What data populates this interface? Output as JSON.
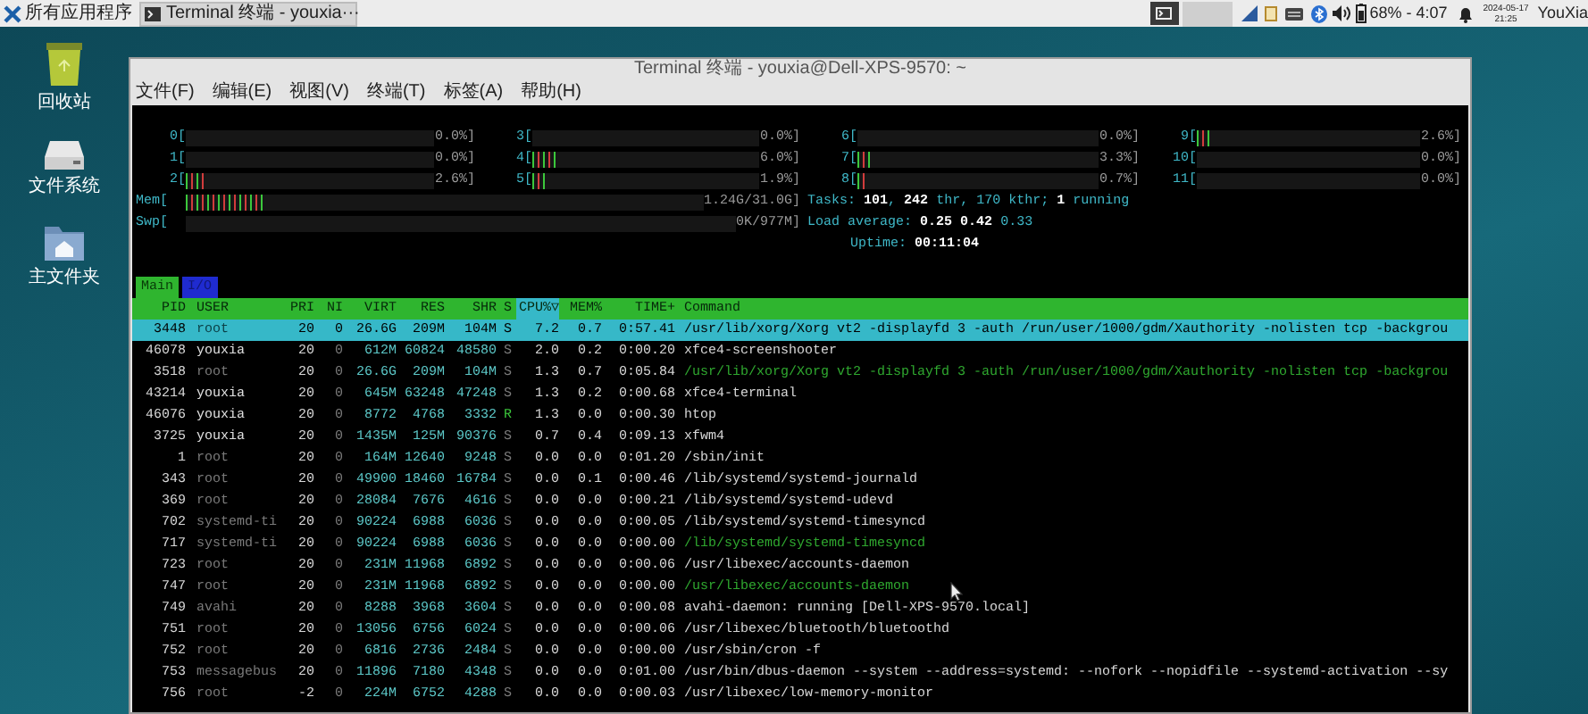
{
  "taskbar": {
    "apps_menu": "所有应用程序",
    "task": "Terminal 终端 - youxia···",
    "battery": "68% - 4:07",
    "date": "2024-05-17",
    "time": "21:25",
    "user": "YouXia"
  },
  "desktop_icons": [
    {
      "kind": "trash",
      "label": "回收站"
    },
    {
      "kind": "drive",
      "label": "文件系统"
    },
    {
      "kind": "home",
      "label": "主文件夹"
    }
  ],
  "window": {
    "title": "Terminal 终端 - youxia@Dell-XPS-9570: ~",
    "menu": [
      "文件(F)",
      "编辑(E)",
      "视图(V)",
      "终端(T)",
      "标签(A)",
      "帮助(H)"
    ]
  },
  "htop": {
    "cpu_columns": [
      [
        {
          "label": "0[",
          "value": "0.0%]",
          "level": 0
        },
        {
          "label": "1[",
          "value": "0.0%]",
          "level": 0
        },
        {
          "label": "2[",
          "value": "2.6%]",
          "level": 0.07
        }
      ],
      [
        {
          "label": "3[",
          "value": "0.0%]",
          "level": 0
        },
        {
          "label": "4[",
          "value": "6.0%]",
          "level": 0.11
        },
        {
          "label": "5[",
          "value": "1.9%]",
          "level": 0.07
        }
      ],
      [
        {
          "label": "6[",
          "value": "0.0%]",
          "level": 0
        },
        {
          "label": "7[",
          "value": "3.3%]",
          "level": 0.07
        },
        {
          "label": "8[",
          "value": "0.7%]",
          "level": 0.036
        }
      ],
      [
        {
          "label": "9[",
          "value": "2.6%]",
          "level": 0.07
        },
        {
          "label": "10[",
          "value": "0.0%]",
          "level": 0
        },
        {
          "label": "11[",
          "value": "0.0%]",
          "level": 0
        }
      ]
    ],
    "memory": [
      {
        "label": "Mem[",
        "value": "1.24G/31.0G]",
        "level": 0.15
      },
      {
        "label": "Swp[",
        "value": "0K/977M]",
        "level": 0
      }
    ],
    "stats": [
      "Tasks: **101**, **242** thr, 170 kthr; **1** running",
      "Load average: **0.25** **0.42** 0.33",
      "Uptime: **00:11:04**"
    ],
    "tabs": [
      {
        "label": "Main",
        "selected": true
      },
      {
        "label": "I/O",
        "selected": false
      }
    ],
    "columns": [
      {
        "label": "PID",
        "sorted": false
      },
      {
        "label": "USER",
        "sorted": false
      },
      {
        "label": "PRI",
        "sorted": false
      },
      {
        "label": "NI",
        "sorted": false
      },
      {
        "label": "VIRT",
        "sorted": false
      },
      {
        "label": "RES",
        "sorted": false
      },
      {
        "label": "SHR",
        "sorted": false
      },
      {
        "label": "S",
        "sorted": false
      },
      {
        "label": "CPU%▽",
        "sorted": true
      },
      {
        "label": "MEM%",
        "sorted": false
      },
      {
        "label": "TIME+",
        "sorted": false
      },
      {
        "label": "Command",
        "sorted": false
      }
    ],
    "rows": [
      {
        "cells": [
          "3448",
          "root",
          "20",
          "0",
          "26.6G",
          "209M",
          "104M",
          "S",
          "7.2",
          "0.7",
          "0:57.41",
          "/usr/lib/xorg/Xorg vt2 -displayfd 3 -auth /run/user/1000/gdm/Xauthority -nolisten tcp -backgrou"
        ],
        "selected": true,
        "own_user": false,
        "thread": false,
        "running": false
      },
      {
        "cells": [
          "46078",
          "youxia",
          "20",
          "0",
          "612M",
          "60824",
          "48580",
          "S",
          "2.0",
          "0.2",
          "0:00.20",
          "xfce4-screenshooter"
        ],
        "selected": false,
        "own_user": true,
        "thread": false,
        "running": false
      },
      {
        "cells": [
          "3518",
          "root",
          "20",
          "0",
          "26.6G",
          "209M",
          "104M",
          "S",
          "1.3",
          "0.7",
          "0:05.84",
          "/usr/lib/xorg/Xorg vt2 -displayfd 3 -auth /run/user/1000/gdm/Xauthority -nolisten tcp -backgrou"
        ],
        "selected": false,
        "own_user": false,
        "thread": true,
        "running": false
      },
      {
        "cells": [
          "43214",
          "youxia",
          "20",
          "0",
          "645M",
          "63248",
          "47248",
          "S",
          "1.3",
          "0.2",
          "0:00.68",
          "xfce4-terminal"
        ],
        "selected": false,
        "own_user": true,
        "thread": false,
        "running": false
      },
      {
        "cells": [
          "46076",
          "youxia",
          "20",
          "0",
          "8772",
          "4768",
          "3332",
          "R",
          "1.3",
          "0.0",
          "0:00.30",
          "htop"
        ],
        "selected": false,
        "own_user": true,
        "thread": false,
        "running": true
      },
      {
        "cells": [
          "3725",
          "youxia",
          "20",
          "0",
          "1435M",
          "125M",
          "90376",
          "S",
          "0.7",
          "0.4",
          "0:09.13",
          "xfwm4"
        ],
        "selected": false,
        "own_user": true,
        "thread": false,
        "running": false
      },
      {
        "cells": [
          "1",
          "root",
          "20",
          "0",
          "164M",
          "12640",
          "9248",
          "S",
          "0.0",
          "0.0",
          "0:01.20",
          "/sbin/init"
        ],
        "selected": false,
        "own_user": false,
        "thread": false,
        "running": false
      },
      {
        "cells": [
          "343",
          "root",
          "20",
          "0",
          "49900",
          "18460",
          "16784",
          "S",
          "0.0",
          "0.1",
          "0:00.46",
          "/lib/systemd/systemd-journald"
        ],
        "selected": false,
        "own_user": false,
        "thread": false,
        "running": false
      },
      {
        "cells": [
          "369",
          "root",
          "20",
          "0",
          "28084",
          "7676",
          "4616",
          "S",
          "0.0",
          "0.0",
          "0:00.21",
          "/lib/systemd/systemd-udevd"
        ],
        "selected": false,
        "own_user": false,
        "thread": false,
        "running": false
      },
      {
        "cells": [
          "702",
          "systemd-ti",
          "20",
          "0",
          "90224",
          "6988",
          "6036",
          "S",
          "0.0",
          "0.0",
          "0:00.05",
          "/lib/systemd/systemd-timesyncd"
        ],
        "selected": false,
        "own_user": false,
        "thread": false,
        "running": false
      },
      {
        "cells": [
          "717",
          "systemd-ti",
          "20",
          "0",
          "90224",
          "6988",
          "6036",
          "S",
          "0.0",
          "0.0",
          "0:00.00",
          "/lib/systemd/systemd-timesyncd"
        ],
        "selected": false,
        "own_user": false,
        "thread": true,
        "running": false
      },
      {
        "cells": [
          "723",
          "root",
          "20",
          "0",
          "231M",
          "11968",
          "6892",
          "S",
          "0.0",
          "0.0",
          "0:00.06",
          "/usr/libexec/accounts-daemon"
        ],
        "selected": false,
        "own_user": false,
        "thread": false,
        "running": false
      },
      {
        "cells": [
          "747",
          "root",
          "20",
          "0",
          "231M",
          "11968",
          "6892",
          "S",
          "0.0",
          "0.0",
          "0:00.00",
          "/usr/libexec/accounts-daemon"
        ],
        "selected": false,
        "own_user": false,
        "thread": true,
        "running": false
      },
      {
        "cells": [
          "749",
          "avahi",
          "20",
          "0",
          "8288",
          "3968",
          "3604",
          "S",
          "0.0",
          "0.0",
          "0:00.08",
          "avahi-daemon: running [Dell-XPS-9570.local]"
        ],
        "selected": false,
        "own_user": false,
        "thread": false,
        "running": false
      },
      {
        "cells": [
          "751",
          "root",
          "20",
          "0",
          "13056",
          "6756",
          "6024",
          "S",
          "0.0",
          "0.0",
          "0:00.06",
          "/usr/libexec/bluetooth/bluetoothd"
        ],
        "selected": false,
        "own_user": false,
        "thread": false,
        "running": false
      },
      {
        "cells": [
          "752",
          "root",
          "20",
          "0",
          "6816",
          "2736",
          "2484",
          "S",
          "0.0",
          "0.0",
          "0:00.00",
          "/usr/sbin/cron -f"
        ],
        "selected": false,
        "own_user": false,
        "thread": false,
        "running": false
      },
      {
        "cells": [
          "753",
          "messagebus",
          "20",
          "0",
          "11896",
          "7180",
          "4348",
          "S",
          "0.0",
          "0.0",
          "0:01.00",
          "/usr/bin/dbus-daemon --system --address=systemd: --nofork --nopidfile --systemd-activation --sy"
        ],
        "selected": false,
        "own_user": false,
        "thread": false,
        "running": false
      },
      {
        "cells": [
          "756",
          "root",
          "-2",
          "0",
          "224M",
          "6752",
          "4288",
          "S",
          "0.0",
          "0.0",
          "0:00.03",
          "/usr/libexec/low-memory-monitor"
        ],
        "selected": false,
        "own_user": false,
        "thread": false,
        "running": false
      }
    ]
  }
}
